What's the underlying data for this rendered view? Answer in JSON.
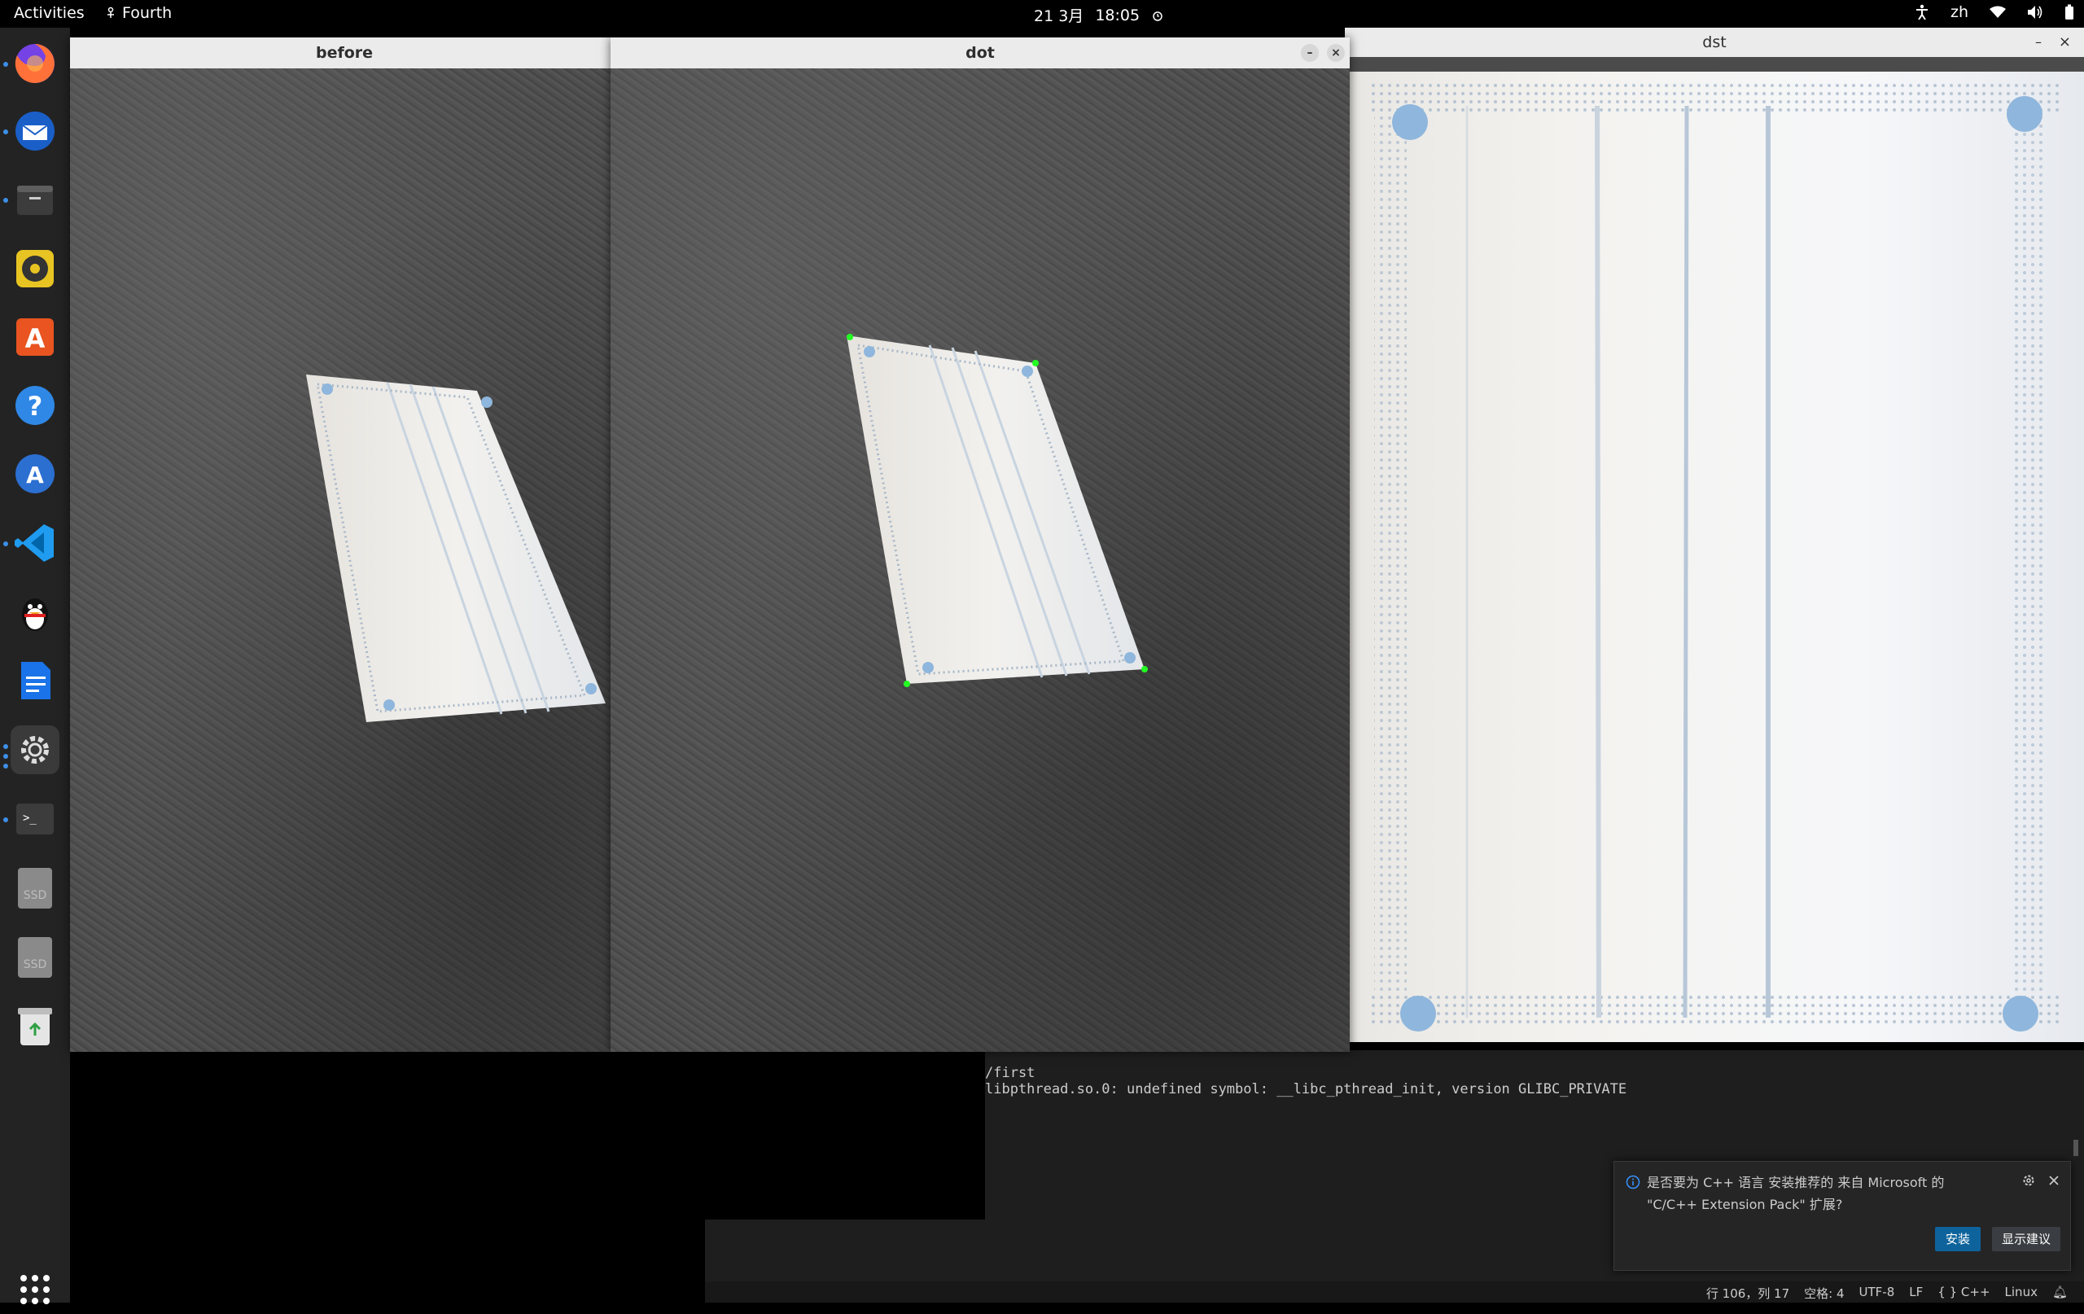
{
  "topbar": {
    "activities": "Activities",
    "app_name": "Fourth",
    "date": "21 3月",
    "time": "18:05",
    "ime": "zh"
  },
  "dock": {
    "items": [
      {
        "name": "firefox",
        "color": "#ff7139"
      },
      {
        "name": "thunderbird",
        "color": "#2a7ae2"
      },
      {
        "name": "files",
        "color": "#4a4a4a"
      },
      {
        "name": "rhythmbox",
        "color": "#f5c211"
      },
      {
        "name": "software",
        "color": "#e95420"
      },
      {
        "name": "help",
        "color": "#2f88e6"
      },
      {
        "name": "app-center",
        "color": "#3584e4"
      },
      {
        "name": "vscode",
        "color": "#0078d4"
      },
      {
        "name": "qq",
        "color": "#111111"
      },
      {
        "name": "writer",
        "color": "#1a73e8"
      },
      {
        "name": "settings",
        "color": "#555555"
      },
      {
        "name": "terminal",
        "color": "#3c3c3c"
      },
      {
        "name": "ssd-1",
        "color": "#8a8a8a",
        "label": "SSD"
      },
      {
        "name": "ssd-2",
        "color": "#8a8a8a",
        "label": "SSD"
      },
      {
        "name": "trash",
        "color": "#d8d8d8"
      }
    ]
  },
  "windows": {
    "before": {
      "title": "before"
    },
    "dot": {
      "title": "dot"
    },
    "dst": {
      "title": "dst"
    }
  },
  "terminal": {
    "line1": "/first",
    "line2": "libpthread.so.0: undefined symbol: __libc_pthread_init, version GLIBC_PRIVATE"
  },
  "notification": {
    "message": "是否要为 C++ 语言 安装推荐的 来自 Microsoft 的 \"C/C++ Extension Pack\" 扩展?",
    "install": "安装",
    "show": "显示建议"
  },
  "statusbar": {
    "position": "行 106，列 17",
    "spaces": "空格: 4",
    "encoding": "UTF-8",
    "eol": "LF",
    "language": "C++",
    "os": "Linux"
  },
  "colors": {
    "accent": "#0e639c",
    "marker": "#22ff22"
  }
}
